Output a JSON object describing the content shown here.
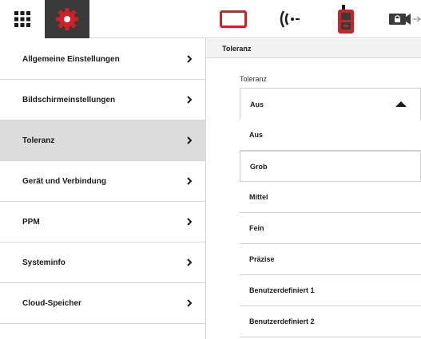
{
  "menu": {
    "items": [
      {
        "label": "Allgemeine Einstellungen"
      },
      {
        "label": "Bildschirmeinstellungen"
      },
      {
        "label": "Toleranz"
      },
      {
        "label": "Gerät und Verbindung"
      },
      {
        "label": "PPM"
      },
      {
        "label": "Systeminfo"
      },
      {
        "label": "Cloud-Speicher"
      }
    ]
  },
  "panel": {
    "header": "Toleranz",
    "field_label": "Toleranz",
    "selected": "Aus",
    "options": [
      "Aus",
      "Grob",
      "Mittel",
      "Fein",
      "Präzise",
      "Benutzerdefiniert 1",
      "Benutzerdefiniert 2"
    ]
  },
  "colors": {
    "accent": "#d0202a",
    "active_tab": "#3a3a3a",
    "active_menu": "#dcdcdc"
  },
  "icons": [
    "grid-menu-icon",
    "gear-icon",
    "screen-icon",
    "signal-icon",
    "device-icon",
    "lock-camera-icon",
    "chevron-right-icon",
    "caret-up-icon"
  ]
}
